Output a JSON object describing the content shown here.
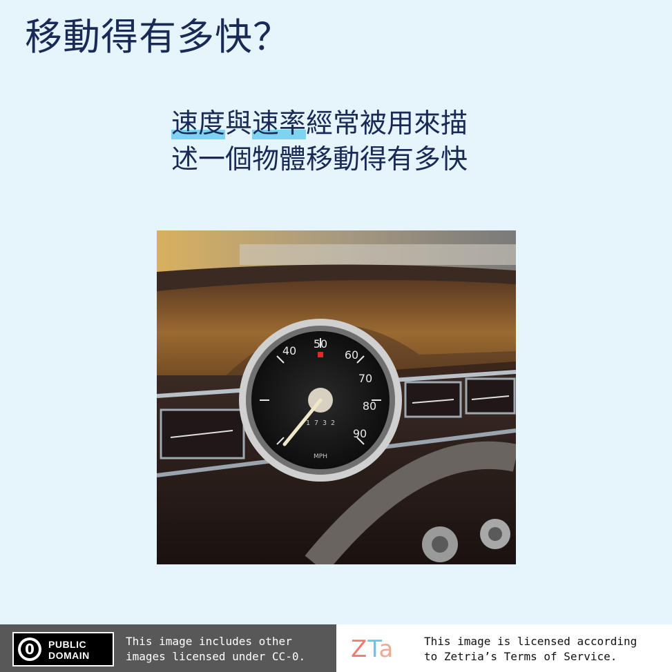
{
  "slide": {
    "title": "移動得有多快？",
    "body": {
      "line1": {
        "hl1": "速度",
        "mid": "與",
        "hl2": "速率",
        "rest": "經常被用來描"
      },
      "line2": "述一個物體移動得有多快"
    }
  },
  "photo": {
    "icon": "speedometer-photo",
    "gauge_numbers": [
      "40",
      "50",
      "60",
      "70",
      "80",
      "90"
    ],
    "gauge_unit": "MPH",
    "odometer": "1 7 3 2",
    "colors": {
      "wood": "#8a5a2a",
      "chrome": "#c8c8c8",
      "dial": "#1c1c1c",
      "needle": "#f0e6c8"
    }
  },
  "footer": {
    "left": {
      "badge_line1": "PUBLIC",
      "badge_line2": "DOMAIN",
      "badge_symbol": "0",
      "note_line1": "This image includes other",
      "note_line2": "images licensed under CC-0."
    },
    "right": {
      "logo_z": "Z",
      "logo_t": "T",
      "logo_a": "a",
      "note_line1": "This image is licensed according",
      "note_line2": "to Zetria’s Terms of Service."
    }
  }
}
